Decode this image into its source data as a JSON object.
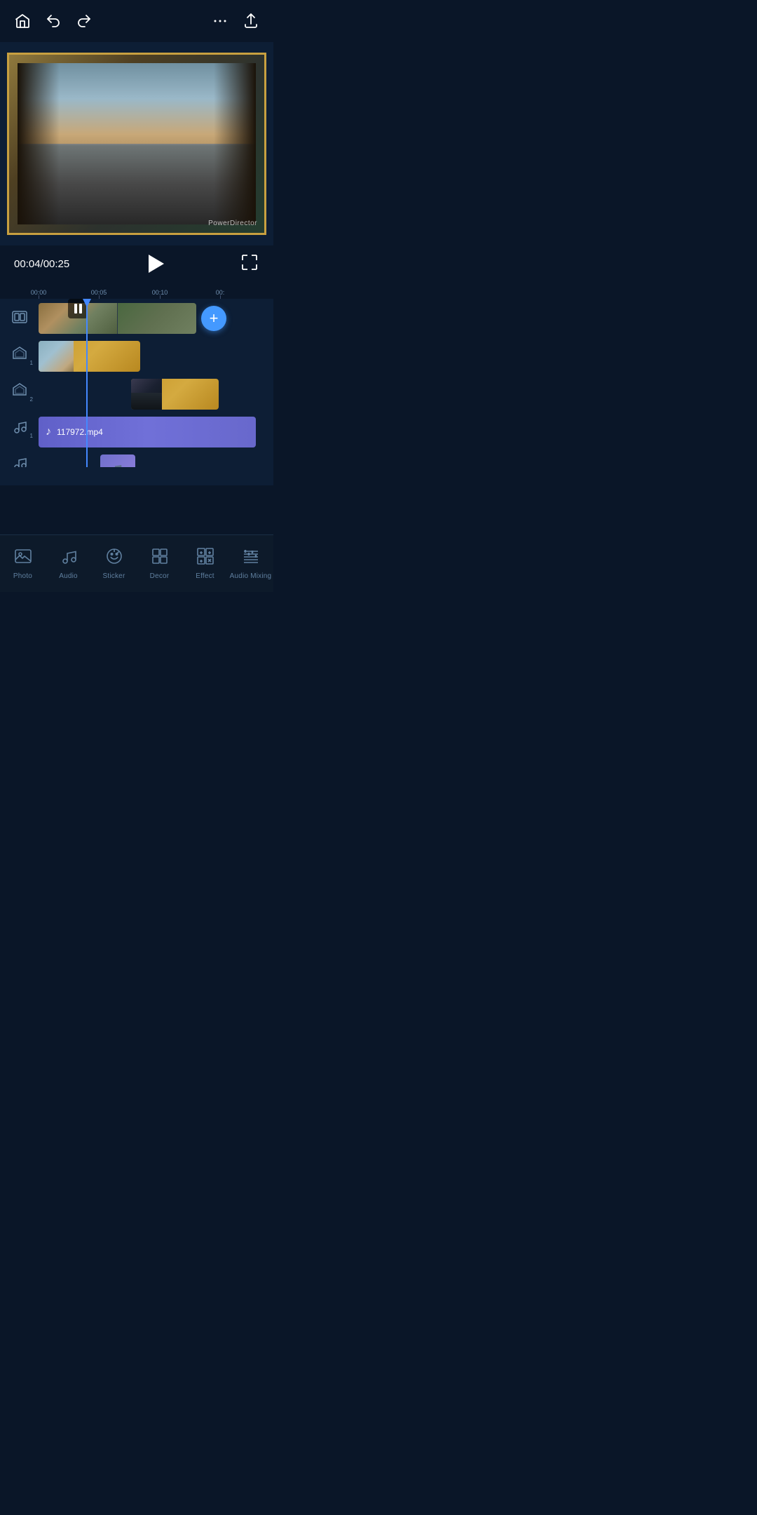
{
  "app": {
    "title": "PowerDirector"
  },
  "topbar": {
    "home_label": "home",
    "undo_label": "undo",
    "redo_label": "redo",
    "more_label": "more",
    "export_label": "export"
  },
  "video": {
    "watermark": "PowerDirector",
    "current_time": "00:04",
    "total_time": "00:25",
    "time_display": "00:04/00:25"
  },
  "timeline": {
    "markers": [
      "00:00",
      "00:05",
      "00:10",
      "00:"
    ],
    "tracks": {
      "main_video": "main-video-track",
      "overlay_1": "overlay-track-1",
      "overlay_2": "overlay-track-2",
      "audio_1": "audio-track-1",
      "audio_2": "audio-track-2"
    },
    "audio_clip_name": "117972.mp4",
    "add_button": "+"
  },
  "bottom_nav": {
    "items": [
      {
        "id": "photo",
        "label": "Photo",
        "active": false
      },
      {
        "id": "audio",
        "label": "Audio",
        "active": false
      },
      {
        "id": "sticker",
        "label": "Sticker",
        "active": false
      },
      {
        "id": "decor",
        "label": "Decor",
        "active": false
      },
      {
        "id": "effect",
        "label": "Effect",
        "active": false
      },
      {
        "id": "audio-mixing",
        "label": "Audio Mixing",
        "active": false
      }
    ]
  }
}
